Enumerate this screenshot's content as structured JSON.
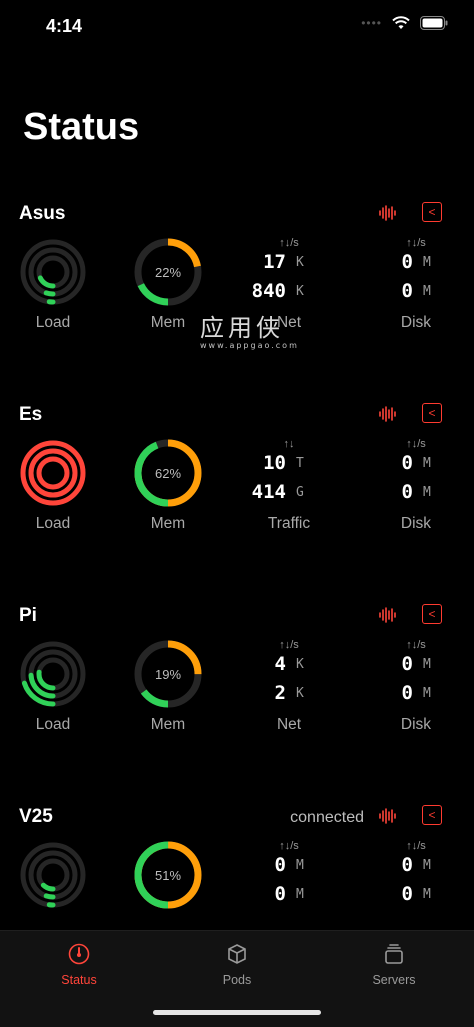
{
  "status_bar": {
    "time": "4:14"
  },
  "page_title": "Status",
  "colors": {
    "accent": "#ff453a",
    "green": "#30d158",
    "orange": "#ff9f0a",
    "red": "#ff453a",
    "track": "#262626"
  },
  "servers": [
    {
      "name": "Asus",
      "status": "",
      "load": {
        "rings": [
          0.02,
          0.05,
          0.18
        ],
        "color": "green"
      },
      "mem": {
        "percent": "22%",
        "used": 0.18,
        "cache": 0.04
      },
      "net": {
        "head": "↑↓/s",
        "up_value": "17",
        "up_unit": "K",
        "down_value": "840",
        "down_unit": "K",
        "label": "Net"
      },
      "disk": {
        "head": "↑↓/s",
        "up_value": "0",
        "up_unit": "M",
        "down_value": "0",
        "down_unit": "M",
        "label": "Disk"
      },
      "load_label": "Load",
      "mem_label": "Mem"
    },
    {
      "name": "Es",
      "status": "",
      "load": {
        "rings": [
          1.0,
          1.0,
          1.0
        ],
        "color": "red"
      },
      "mem": {
        "percent": "62%",
        "used": 0.44,
        "cache": 0.38
      },
      "net": {
        "head": "↑↓",
        "up_value": "10",
        "up_unit": "T",
        "down_value": "414",
        "down_unit": "G",
        "label": "Traffic"
      },
      "disk": {
        "head": "↑↓/s",
        "up_value": "0",
        "up_unit": "M",
        "down_value": "0",
        "down_unit": "M",
        "label": "Disk"
      },
      "load_label": "Load",
      "mem_label": "Mem"
    },
    {
      "name": "Pi",
      "status": "",
      "load": {
        "rings": [
          0.2,
          0.24,
          0.27
        ],
        "color": "green"
      },
      "mem": {
        "percent": "19%",
        "used": 0.15,
        "cache": 0.1
      },
      "net": {
        "head": "↑↓/s",
        "up_value": "4",
        "up_unit": "K",
        "down_value": "2",
        "down_unit": "K",
        "label": "Net"
      },
      "disk": {
        "head": "↑↓/s",
        "up_value": "0",
        "up_unit": "M",
        "down_value": "0",
        "down_unit": "M",
        "label": "Disk"
      },
      "load_label": "Load",
      "mem_label": "Mem"
    },
    {
      "name": "V25",
      "status": "connected",
      "load": {
        "rings": [
          0.02,
          0.05,
          0.12
        ],
        "color": "green"
      },
      "mem": {
        "percent": "51%",
        "used": 0.5,
        "cache": 0.46
      },
      "net": {
        "head": "↑↓/s",
        "up_value": "0",
        "up_unit": "M",
        "down_value": "0",
        "down_unit": "M",
        "label": ""
      },
      "disk": {
        "head": "↑↓/s",
        "up_value": "0",
        "up_unit": "M",
        "down_value": "0",
        "down_unit": "M",
        "label": ""
      },
      "load_label": "",
      "mem_label": ""
    }
  ],
  "tabs": [
    {
      "label": "Status",
      "icon": "gauge-icon",
      "active": true
    },
    {
      "label": "Pods",
      "icon": "box-icon",
      "active": false
    },
    {
      "label": "Servers",
      "icon": "stack-icon",
      "active": false
    }
  ],
  "watermark": {
    "title": "应用侠",
    "sub": "www.appgao.com"
  }
}
